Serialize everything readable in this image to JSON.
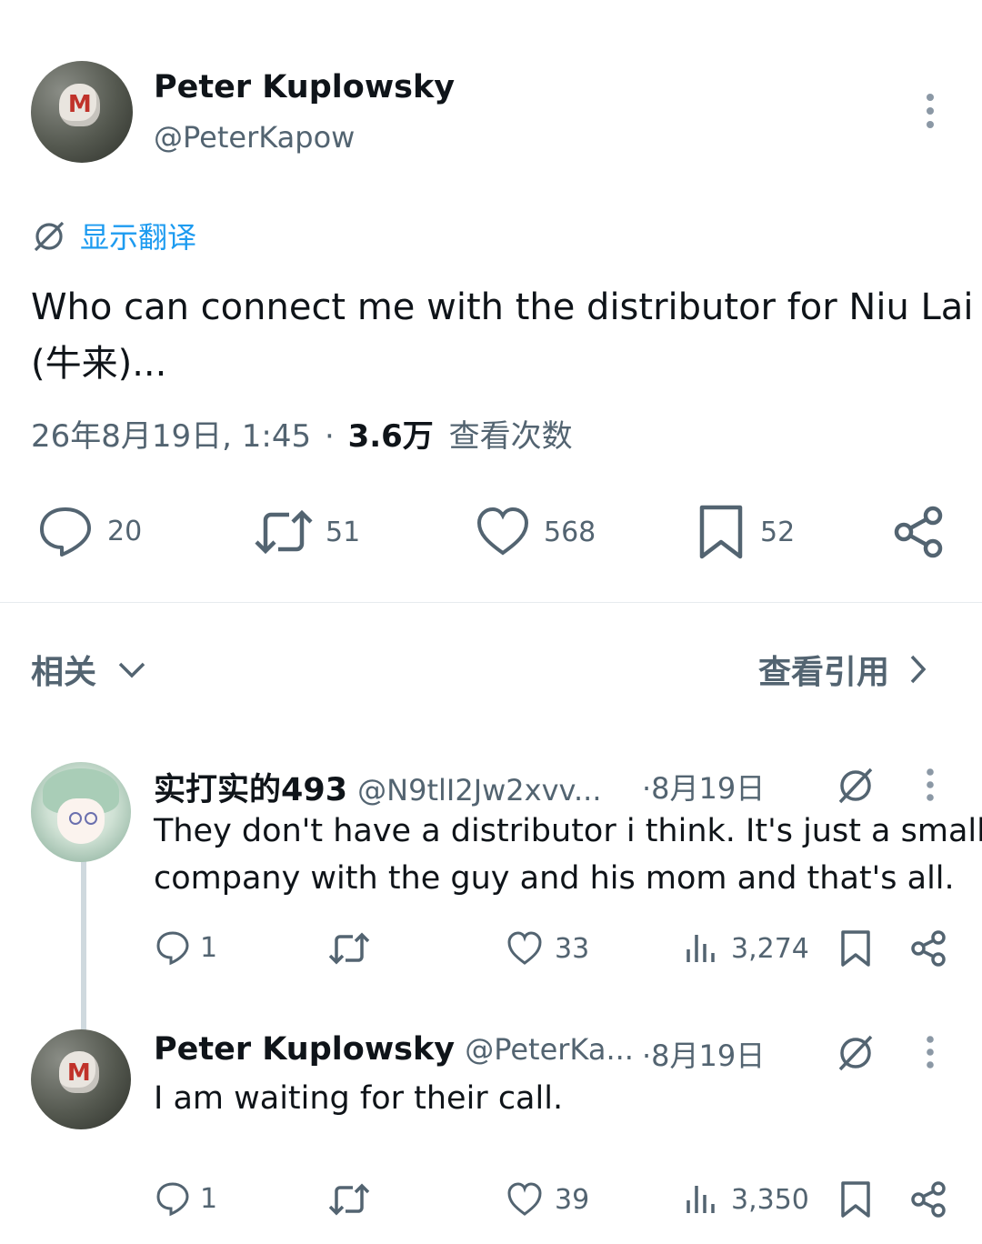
{
  "post": {
    "author": {
      "name": "Peter Kuplowsky",
      "handle": "@PeterKapow",
      "avatar_letter": "M"
    },
    "translate_label": "显示翻译",
    "text_line1": "Who can connect me with the distributor for Niu Lai",
    "text_line2": "(牛来)...",
    "timestamp": "26年8月19日, 1:45",
    "separator": "·",
    "views_count": "3.6万",
    "views_label": "查看次数",
    "actions": {
      "reply": "20",
      "retweet": "51",
      "like": "568",
      "bookmark": "52"
    }
  },
  "related": {
    "label": "相关",
    "quotes_link": "查看引用"
  },
  "replies": [
    {
      "name": "实打实的493",
      "handle": "@N9tlI2Jw2xvv...",
      "date": "·8月19日",
      "text_line1": "They don't have a distributor i think. It's just a small",
      "text_line2": "company with the guy and his mom and that's all.",
      "reply_count": "1",
      "like_count": "33",
      "views_count": "3,274"
    },
    {
      "name": "Peter Kuplowsky",
      "handle": "@PeterKa...",
      "date": "·8月19日",
      "text_line1": "I am waiting for their call.",
      "reply_count": "1",
      "like_count": "39",
      "views_count": "3,350",
      "avatar_letter": "M"
    }
  ],
  "colors": {
    "link_blue": "#1d9bf0",
    "text": "#0f1419",
    "secondary": "#536471",
    "divider": "#e7ebee"
  }
}
